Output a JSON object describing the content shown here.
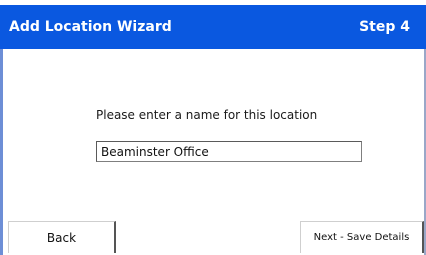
{
  "wizard": {
    "title": "Add Location Wizard",
    "step": "Step 4",
    "prompt": "Please enter a name for this location",
    "name_value": "Beaminster Office",
    "back_label": "Back",
    "next_label": "Next - Save Details"
  },
  "colors": {
    "title_bar": "#0a58e0",
    "title_text": "#ffffff",
    "background": "#ffffff"
  }
}
